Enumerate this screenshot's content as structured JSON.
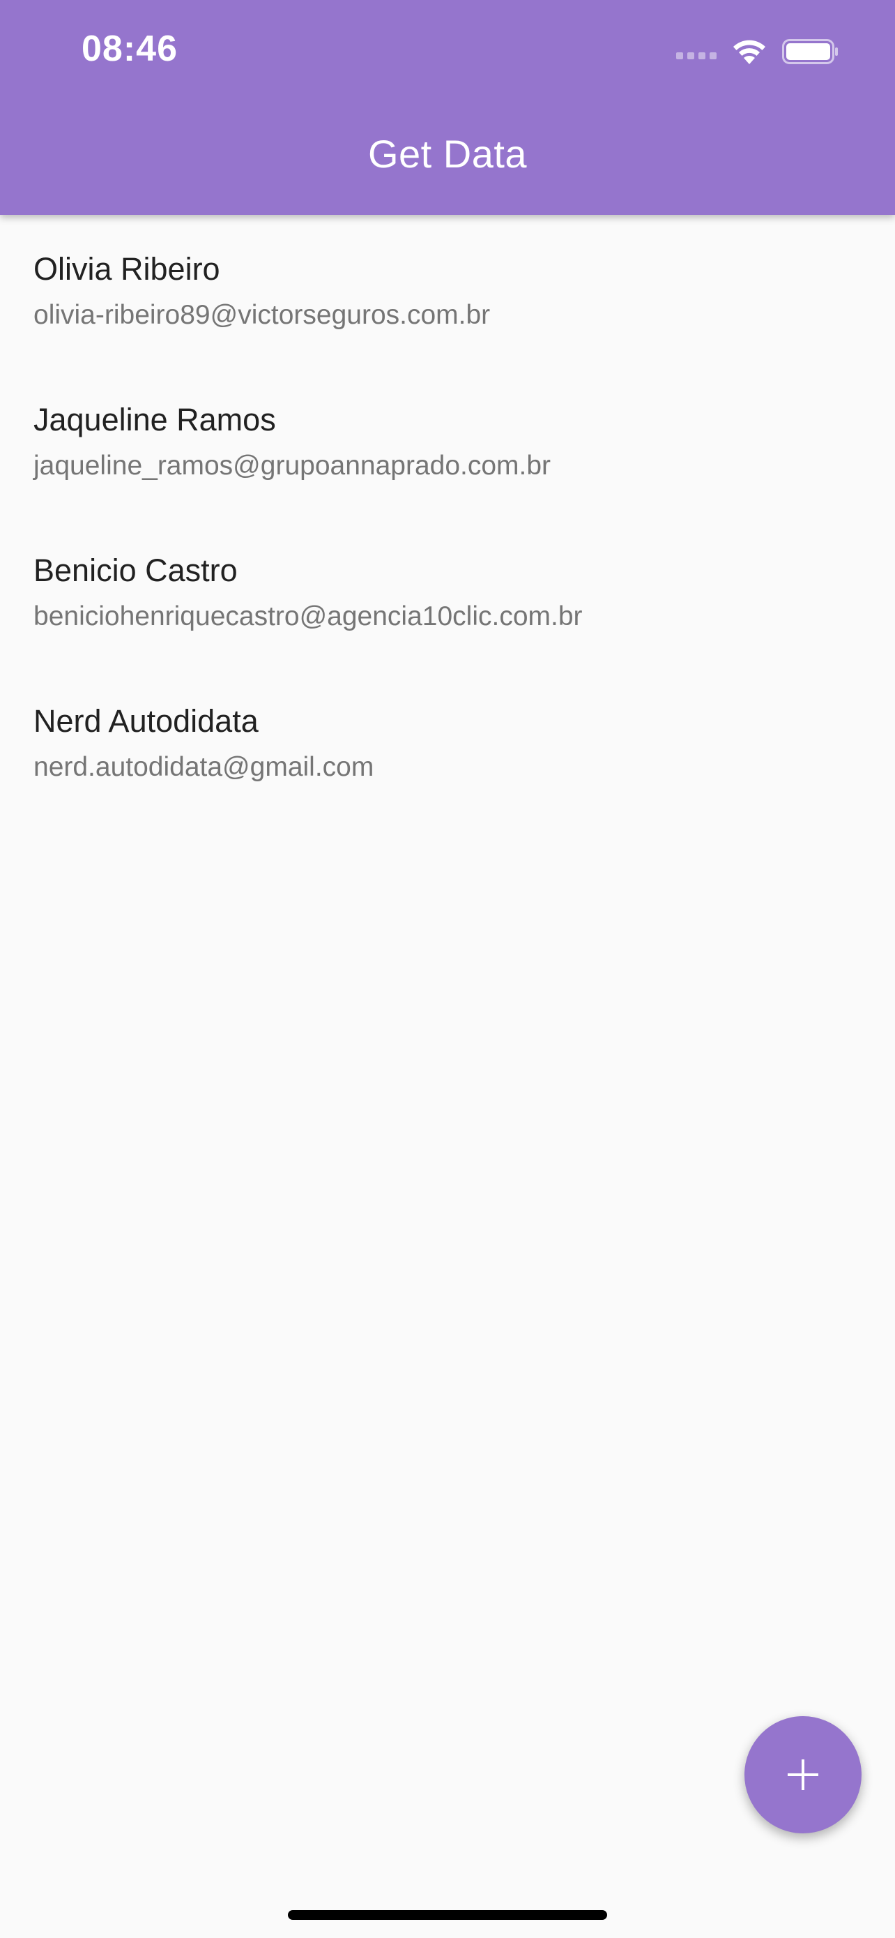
{
  "status_bar": {
    "time": "08:46"
  },
  "app_bar": {
    "title": "Get Data",
    "color": "#9575cd"
  },
  "contacts": [
    {
      "name": "Olivia Ribeiro",
      "email": "olivia-ribeiro89@victorseguros.com.br"
    },
    {
      "name": "Jaqueline Ramos",
      "email": "jaqueline_ramos@grupoannaprado.com.br"
    },
    {
      "name": "Benicio Castro",
      "email": "beniciohenriquecastro@agencia10clic.com.br"
    },
    {
      "name": "Nerd Autodidata",
      "email": "nerd.autodidata@gmail.com"
    }
  ],
  "fab": {
    "icon": "plus-icon"
  }
}
